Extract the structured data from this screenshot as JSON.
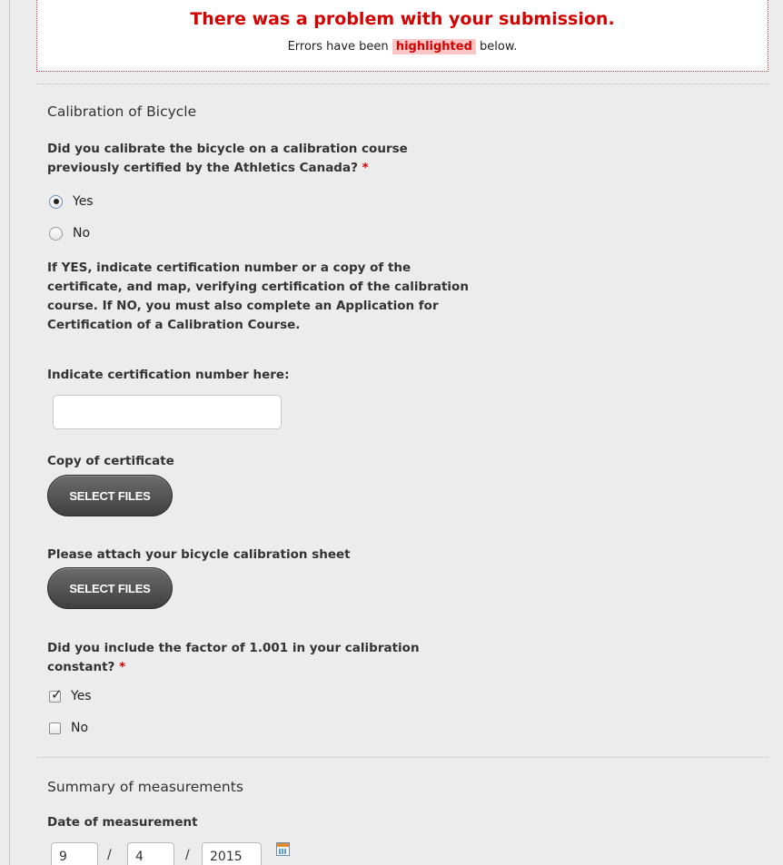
{
  "error_banner": {
    "title": "There was a problem with your submission.",
    "subtitle_before": "Errors have been ",
    "subtitle_highlight": "highlighted",
    "subtitle_after": " below."
  },
  "section_calibration": {
    "title": "Calibration of Bicycle",
    "q1": {
      "label": "Did you calibrate the bicycle on a calibration course previously certified by the Athletics Canada?",
      "required_mark": "*",
      "options": [
        "Yes",
        "No"
      ],
      "selected": "Yes"
    },
    "instructions": "If YES, indicate certification number or a copy of the certificate, and map, verifying certification of the calibration course. If NO, you must also complete an Application for Certification of a Calibration Course.",
    "cert_number_label": "Indicate certification number here:",
    "cert_number_value": "",
    "copy_label": "Copy of certificate",
    "copy_button": "SELECT FILES",
    "attach_label": "Please attach your bicycle calibration sheet",
    "attach_button": "SELECT FILES",
    "q2": {
      "label": "Did you include the factor of 1.001 in your calibration constant?",
      "required_mark": "*",
      "options": [
        "Yes",
        "No"
      ],
      "checked": [
        "Yes"
      ]
    }
  },
  "section_summary": {
    "title": "Summary of measurements",
    "date_label": "Date of measurement",
    "date_day": "9",
    "date_month": "4",
    "date_year": "2015",
    "date_separator": "/",
    "calendar_icon": "calendar-icon"
  }
}
